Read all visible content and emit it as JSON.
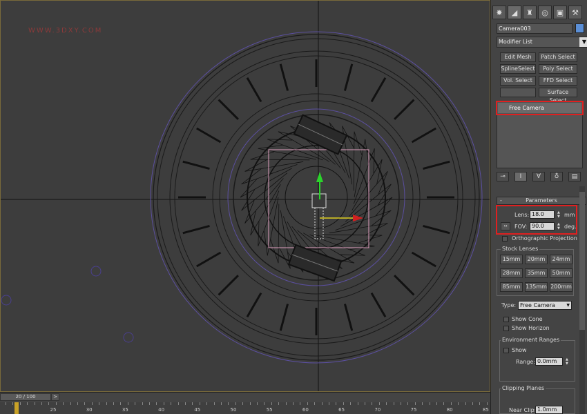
{
  "viewport": {
    "watermark": "WWW.3DXY.COM"
  },
  "timeline": {
    "frame_counter": "20 / 100",
    "next_label": ">",
    "ruler_labels": [
      "25",
      "30",
      "35",
      "40",
      "45",
      "50",
      "55",
      "60",
      "65",
      "70",
      "75",
      "80",
      "85"
    ]
  },
  "panel": {
    "tabs": [
      {
        "icon": "create-icon",
        "glyph": "✸"
      },
      {
        "icon": "modify-icon",
        "glyph": "◢"
      },
      {
        "icon": "hierarchy-icon",
        "glyph": "♜"
      },
      {
        "icon": "motion-icon",
        "glyph": "◎"
      },
      {
        "icon": "display-icon",
        "glyph": "▣"
      },
      {
        "icon": "utilities-icon",
        "glyph": "⚒"
      }
    ],
    "object_name": "Camera003",
    "object_color": "#5b8fd6",
    "modifier_list": "Modifier List",
    "modifier_buttons": {
      "edit_mesh": "Edit Mesh",
      "patch_select": "Patch Select",
      "spline_select": "SplineSelect",
      "poly_select": "Poly Select",
      "vol_select": "Vol. Select",
      "ffd_select": "FFD Select",
      "surface_select": "Surface Select"
    },
    "stack_item": "Free Camera",
    "highlight_color": "#e02020",
    "parameters": {
      "title": "Parameters",
      "lens_label": "Lens:",
      "lens_value": "18.0",
      "lens_unit": "mm",
      "fov_label": "FOV:",
      "fov_value": "90.0",
      "fov_unit": "deg.",
      "ortho_label": "Orthographic Projection",
      "stock_lenses_title": "Stock Lenses",
      "stock_lenses": [
        "15mm",
        "20mm",
        "24mm",
        "28mm",
        "35mm",
        "50mm",
        "85mm",
        "135mm",
        "200mm"
      ],
      "type_label": "Type:",
      "type_value": "Free Camera",
      "show_cone": "Show Cone",
      "show_horizon": "Show Horizon",
      "env_ranges_title": "Environment Ranges",
      "env_show": "Show",
      "near_range_label": "Range:",
      "near_range_value": "0.0mm",
      "clipping_title": "Clipping Planes",
      "near_clip_label": "Near Clip:",
      "near_clip_value": "1.0mm"
    }
  }
}
